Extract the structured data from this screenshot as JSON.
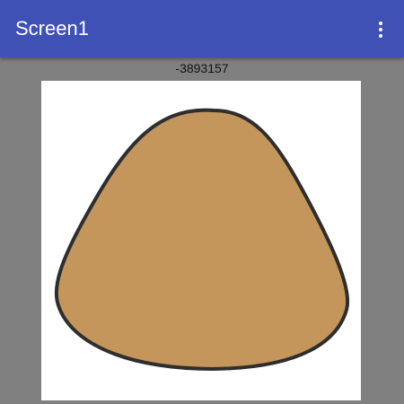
{
  "app_bar": {
    "title": "Screen1",
    "menu_icon": "more-vert-icon",
    "color": "#3f51b5"
  },
  "value_label": "-3893157",
  "canvas": {
    "background": "#ffffff",
    "shape": {
      "fill": "#c4965c",
      "stroke": "#2e2e2e"
    }
  },
  "colors": {
    "screen_background": "#808080"
  }
}
